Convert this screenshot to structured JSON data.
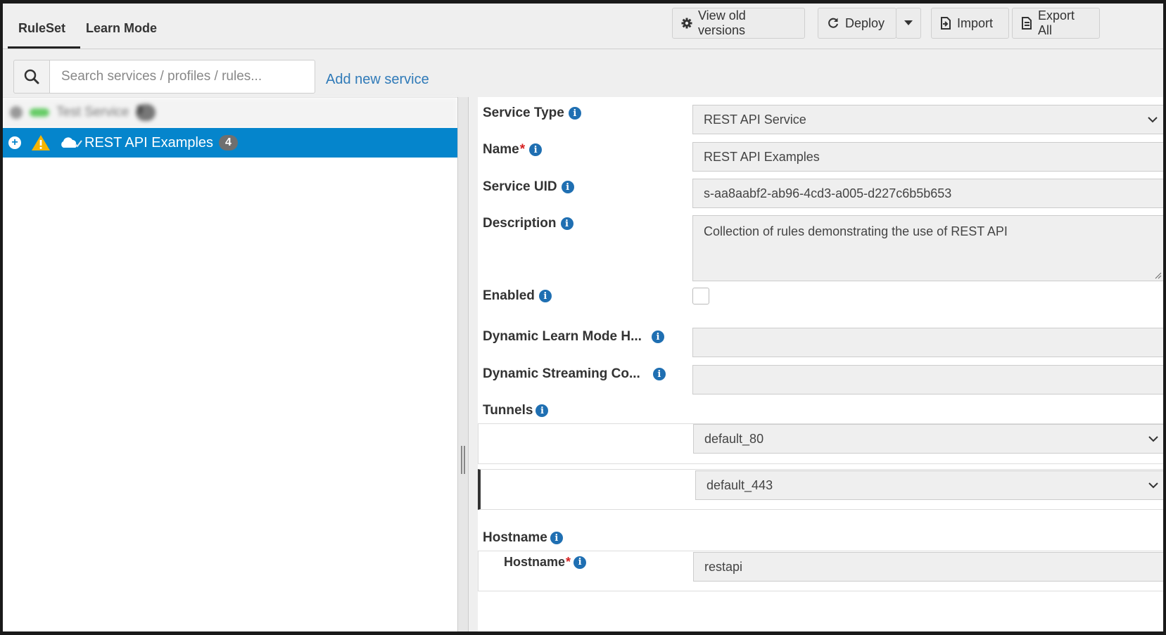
{
  "tabs": [
    {
      "label": "RuleSet"
    },
    {
      "label": "Learn Mode"
    }
  ],
  "toolbar": {
    "view_old_versions": "View old versions",
    "deploy": "Deploy",
    "import": "Import",
    "export_all": "Export All"
  },
  "search": {
    "placeholder": "Search services / profiles / rules..."
  },
  "add_new_service": "Add new service",
  "tree": {
    "blurred_item": {
      "label": "Test Service",
      "count": "3"
    },
    "selected_item": {
      "label": "REST API Examples",
      "count": "4"
    }
  },
  "form": {
    "service_type": {
      "label": "Service Type",
      "value": "REST API Service"
    },
    "name": {
      "label": "Name",
      "required": "*",
      "value": "REST API Examples"
    },
    "service_uid": {
      "label": "Service UID",
      "value": "s-aa8aabf2-ab96-4cd3-a005-d227c6b5b653"
    },
    "description": {
      "label": "Description",
      "value": "Collection of rules demonstrating the use of REST API"
    },
    "enabled": {
      "label": "Enabled",
      "checked": false
    },
    "dynamic_learn_mode": {
      "label": "Dynamic Learn Mode H...",
      "value": ""
    },
    "dynamic_streaming": {
      "label": "Dynamic Streaming Co...",
      "value": ""
    },
    "tunnels": {
      "label": "Tunnels",
      "items": [
        "default_80",
        "default_443"
      ]
    },
    "hostname_section": {
      "label": "Hostname"
    },
    "hostname": {
      "label": "Hostname",
      "required": "*",
      "value": "restapi"
    }
  },
  "colors": {
    "selection": "#0585cc",
    "link": "#2f7ab8",
    "info": "#1f6fb2",
    "required": "#d62020",
    "warning": "#f5b400"
  }
}
